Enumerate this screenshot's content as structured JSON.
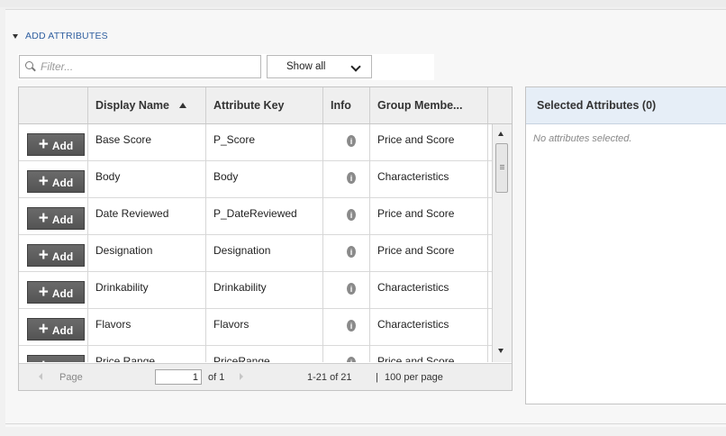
{
  "section": {
    "title": "ADD ATTRIBUTES"
  },
  "filter": {
    "placeholder": "Filter...",
    "show_label": "Show all"
  },
  "table": {
    "columns": [
      "Display Name",
      "Attribute Key",
      "Info",
      "Group Membe..."
    ],
    "sorted_column": "Display Name",
    "sort_direction": "ascending",
    "add_label": "Add",
    "rows": [
      {
        "display_name": "Base Score",
        "attribute_key": "P_Score",
        "group": "Price and Score"
      },
      {
        "display_name": "Body",
        "attribute_key": "Body",
        "group": "Characteristics"
      },
      {
        "display_name": "Date Reviewed",
        "attribute_key": "P_DateReviewed",
        "group": "Price and Score"
      },
      {
        "display_name": "Designation",
        "attribute_key": "Designation",
        "group": "Price and Score"
      },
      {
        "display_name": "Drinkability",
        "attribute_key": "Drinkability",
        "group": "Characteristics"
      },
      {
        "display_name": "Flavors",
        "attribute_key": "Flavors",
        "group": "Characteristics"
      },
      {
        "display_name": "Price Range",
        "attribute_key": "PriceRange",
        "group": "Price and Score"
      }
    ]
  },
  "pager": {
    "page_label": "Page",
    "current_page": "1",
    "of_label": "of 1",
    "range": "1-21 of 21",
    "separator": "|",
    "per_page": "100 per page"
  },
  "selected": {
    "title": "Selected Attributes (0)",
    "empty_text": "No attributes selected."
  },
  "colors": {
    "link": "#2f5fa0",
    "add_button": "#5c5c5c",
    "selected_header": "#e6eef7"
  }
}
